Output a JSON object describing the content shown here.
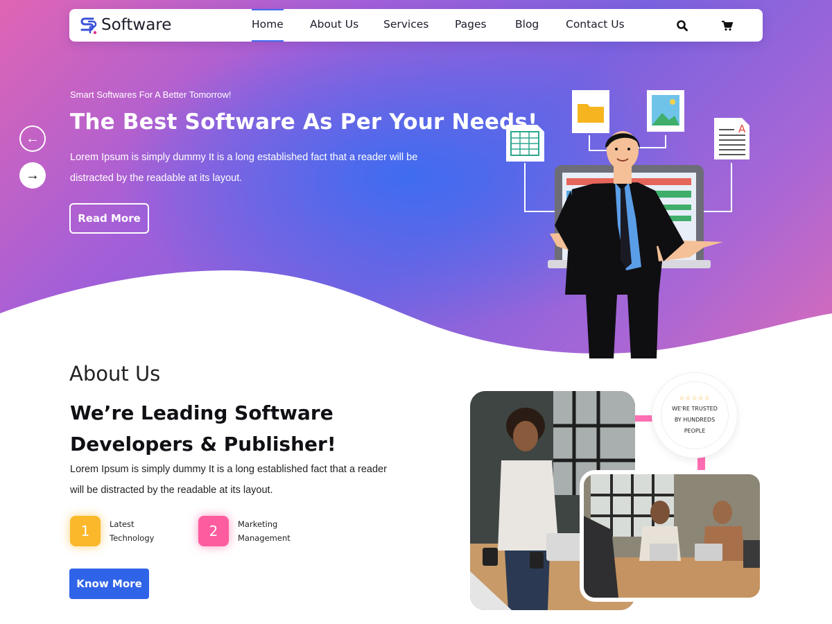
{
  "brand": {
    "name": "Software"
  },
  "nav": {
    "items": [
      {
        "label": "Home"
      },
      {
        "label": "About Us"
      },
      {
        "label": "Services"
      },
      {
        "label": "Pages"
      },
      {
        "label": "Blog"
      },
      {
        "label": "Contact Us"
      }
    ],
    "active": "Home",
    "icons": [
      "search-icon",
      "cart-icon"
    ]
  },
  "hero": {
    "tagline": "Smart Softwares For A Better Tomorrow!",
    "title": "The Best Software As Per Your Needs!",
    "description": "Lorem Ipsum is simply dummy It is a long established fact that a reader will be distracted by the readable at its layout.",
    "button": "Read More",
    "prev_icon": "arrow-left-icon",
    "next_icon": "arrow-right-icon"
  },
  "about": {
    "heading": "About Us",
    "title": "We’re Leading Software Developers & Publisher!",
    "description": "Lorem Ipsum is simply dummy It is a long established fact that a reader will be distracted by the readable at its layout.",
    "features": [
      {
        "number": "1",
        "line1": "Latest",
        "line2": "Technology",
        "color": "#fbb82a"
      },
      {
        "number": "2",
        "line1": "Marketing",
        "line2": "Management",
        "color": "#fd5c9e"
      }
    ],
    "button": "Know More",
    "trust": {
      "stars": "☆☆☆☆☆",
      "line1": "WE'RE TRUSTED",
      "line2": "BY HUNDREDS",
      "line3": "PEOPLE"
    }
  },
  "colors": {
    "accent": "#2f63e8",
    "pink": "#ff6fb4",
    "yellow": "#fbb82a"
  }
}
